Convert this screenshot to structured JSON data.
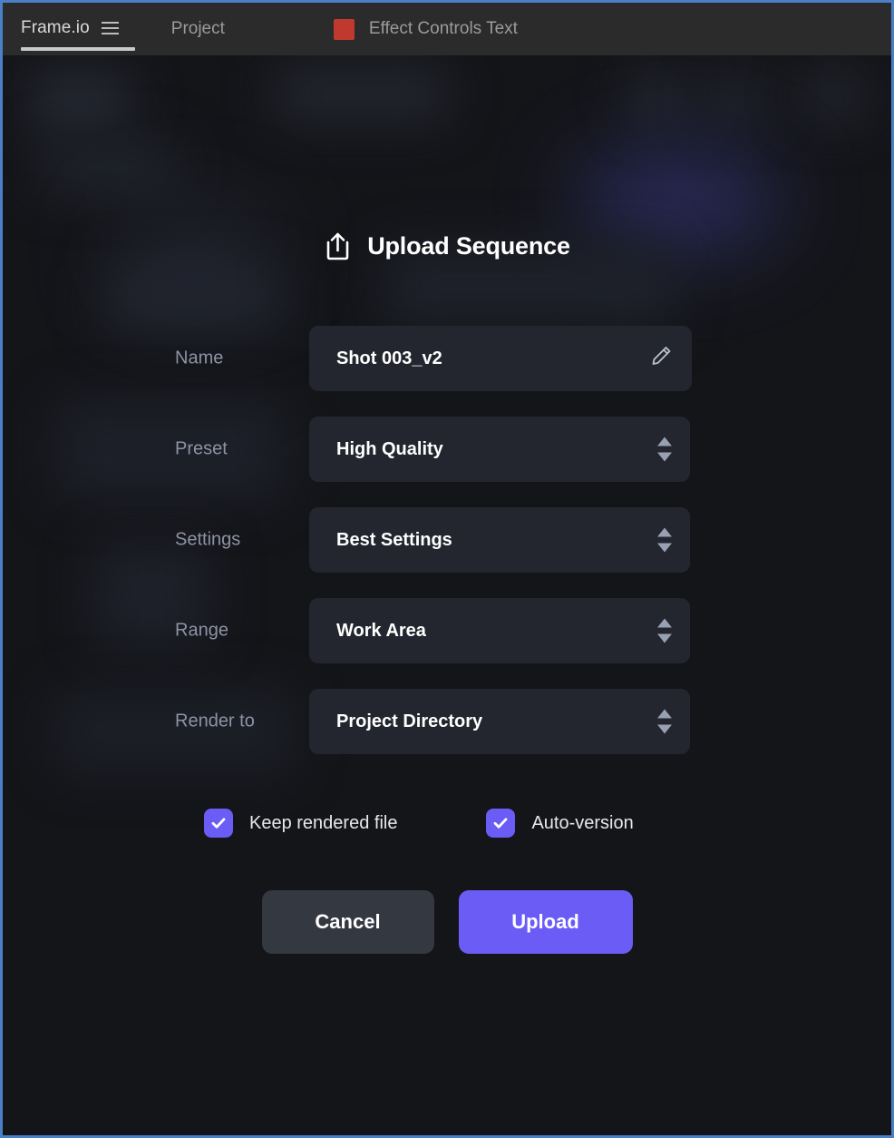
{
  "window": {
    "border_color": "#4a80c6",
    "background": "#141519"
  },
  "topbar": {
    "app_tab": {
      "label": "Frame.io",
      "menu_icon": "hamburger-icon",
      "active": true
    },
    "project_tab": {
      "label": "Project"
    },
    "effect_tab": {
      "label": "Effect Controls Text",
      "swatch_icon": "red-square-icon",
      "swatch_color": "#c0392f"
    }
  },
  "dialog": {
    "title": "Upload Sequence",
    "title_icon": "upload-icon",
    "fields": [
      {
        "label": "Name",
        "value": "Shot 003_v2",
        "control": "text",
        "icon": "pencil-icon",
        "name": "name"
      },
      {
        "label": "Preset",
        "value": "High Quality",
        "control": "stepper",
        "name": "preset"
      },
      {
        "label": "Settings",
        "value": "Best Settings",
        "control": "stepper",
        "name": "settings"
      },
      {
        "label": "Range",
        "value": "Work Area",
        "control": "stepper",
        "name": "range"
      },
      {
        "label": "Render to",
        "value": "Project Directory",
        "control": "stepper",
        "name": "render-to"
      }
    ],
    "checkboxes": [
      {
        "label": "Keep rendered file",
        "checked": true,
        "name": "keep-rendered-file"
      },
      {
        "label": "Auto-version",
        "checked": true,
        "name": "auto-version"
      }
    ],
    "buttons": {
      "cancel": "Cancel",
      "upload": "Upload"
    },
    "accent_color": "#6b5cf5",
    "field_background": "#23262e",
    "label_color": "#8d93a3"
  }
}
